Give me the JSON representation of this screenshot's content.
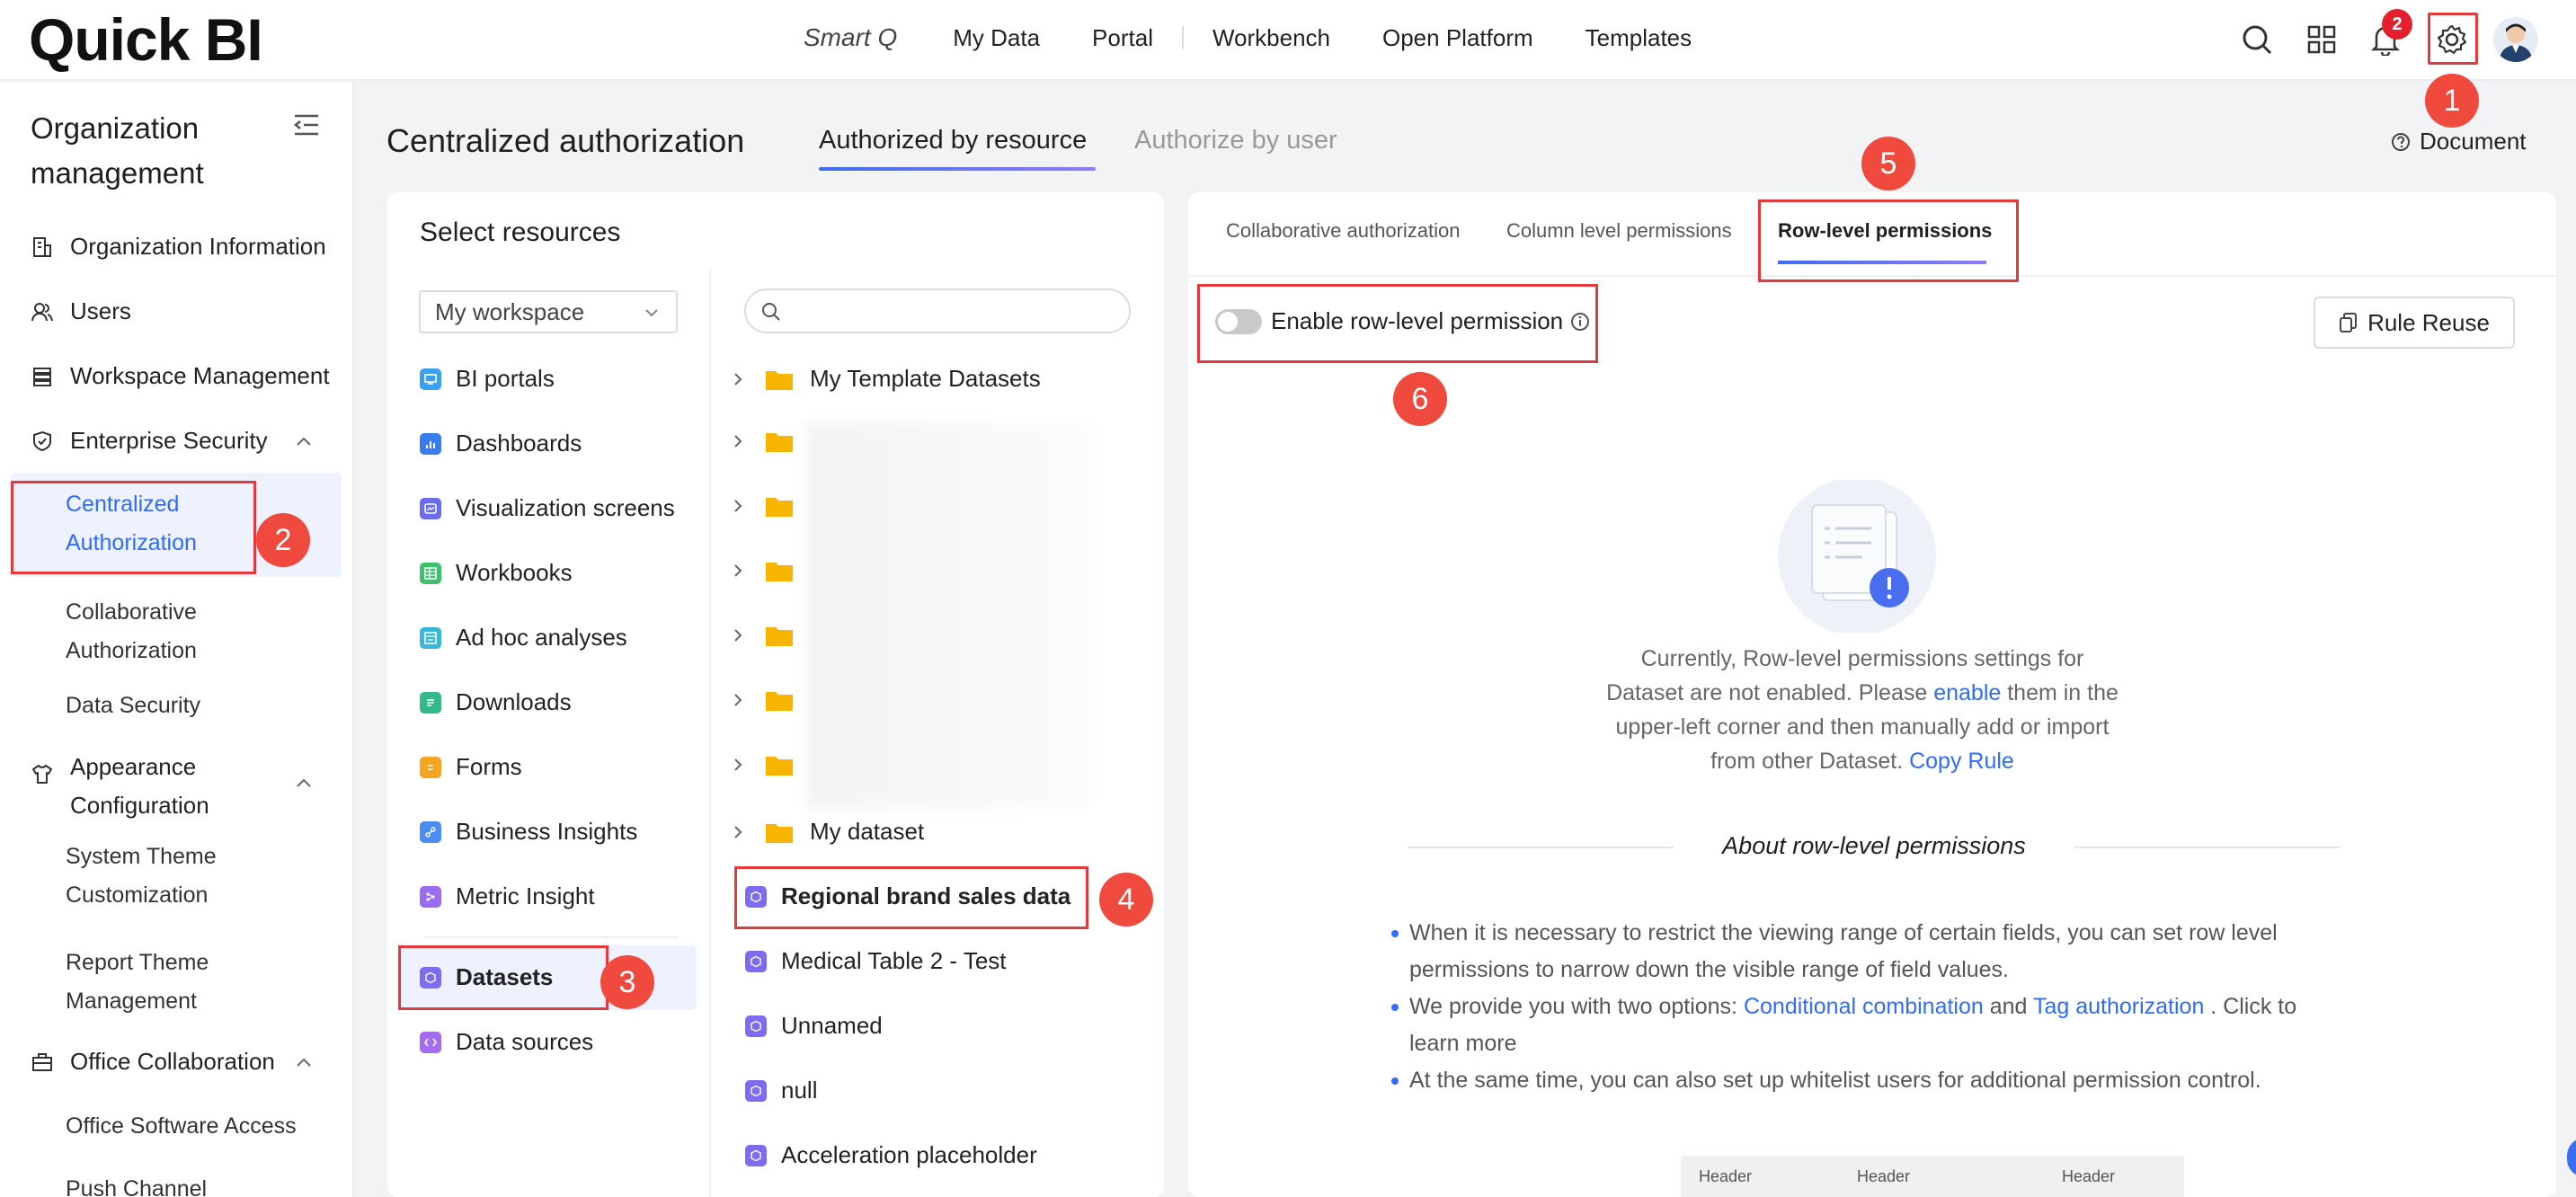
{
  "app": {
    "logo": "Quick BI",
    "nav": [
      "Smart Q",
      "My Data",
      "Portal",
      "Workbench",
      "Open Platform",
      "Templates"
    ],
    "notification_count": "2"
  },
  "sidebar": {
    "title": "Organization management",
    "items": [
      {
        "label": "Organization Information",
        "icon": "building-icon"
      },
      {
        "label": "Users",
        "icon": "users-icon"
      },
      {
        "label": "Workspace Management",
        "icon": "stack-icon"
      },
      {
        "label": "Enterprise Security",
        "icon": "shield-icon"
      }
    ],
    "security_children": [
      "Centralized Authorization",
      "Collaborative Authorization",
      "Data Security"
    ],
    "appearance": {
      "label": "Appearance Configuration",
      "icon": "shirt-icon"
    },
    "appearance_children": [
      "System Theme Customization",
      "Report Theme Management"
    ],
    "office": {
      "label": "Office Collaboration",
      "icon": "briefcase-icon"
    },
    "office_children": [
      "Office Software Access",
      "Push Channel"
    ]
  },
  "header": {
    "title": "Centralized authorization",
    "tabs": [
      "Authorized by resource",
      "Authorize by user"
    ],
    "document": "Document"
  },
  "resources": {
    "title": "Select resources",
    "workspace": "My workspace",
    "types": [
      {
        "label": "BI portals",
        "color": "#3aa0f0"
      },
      {
        "label": "Dashboards",
        "color": "#3a7cf0"
      },
      {
        "label": "Visualization screens",
        "color": "#6a6cf0"
      },
      {
        "label": "Workbooks",
        "color": "#3fbf6f"
      },
      {
        "label": "Ad hoc analyses",
        "color": "#3ab6d8"
      },
      {
        "label": "Downloads",
        "color": "#34b98a"
      },
      {
        "label": "Forms",
        "color": "#f5a524"
      },
      {
        "label": "Business Insights",
        "color": "#4a8cf0"
      },
      {
        "label": "Metric Insight",
        "color": "#9a6cf0"
      },
      {
        "label": "Datasets",
        "color": "#7d6cf0"
      },
      {
        "label": "Data sources",
        "color": "#a46cf0"
      }
    ],
    "search_placeholder": "",
    "folders": [
      "My Template Datasets",
      "",
      "",
      "",
      "",
      "",
      "",
      "My dataset"
    ],
    "datasets": [
      "Regional brand sales data",
      "Medical Table 2 - Test",
      "Unnamed",
      "null",
      "Acceleration placeholder"
    ]
  },
  "rowlevel": {
    "subtabs": [
      "Collaborative authorization",
      "Column level permissions",
      "Row-level permissions"
    ],
    "toggle_label": "Enable row-level permission",
    "rule_reuse": "Rule Reuse",
    "empty": {
      "line1": "Currently, Row-level permissions settings for",
      "line2a": "Dataset are not enabled. Please ",
      "link_enable": "enable",
      "line2b": " them in the",
      "line3": "upper-left corner and then manually add or import",
      "line4a": "from other Dataset. ",
      "link_copy": "Copy Rule"
    },
    "about_title": "About row-level permissions",
    "bullet1": "When it is necessary to restrict the viewing range of certain fields, you can set row level permissions to narrow down the visible range of field values.",
    "bullet2a": "We provide you with two options: ",
    "link_cond": "Conditional combination",
    "bullet2b": " and ",
    "link_tag": "Tag authorization",
    "bullet2c": " . Click to learn more",
    "bullet3": "At the same time, you can also set up whitelist users for additional permission control.",
    "table_headers": [
      "Header",
      "Header",
      "Header"
    ]
  },
  "markers": [
    "1",
    "2",
    "3",
    "4",
    "5",
    "6"
  ],
  "colors": {
    "accent": "#2f6bff",
    "marker": "#ef4a3d",
    "highlight_border": "#e5393c"
  }
}
